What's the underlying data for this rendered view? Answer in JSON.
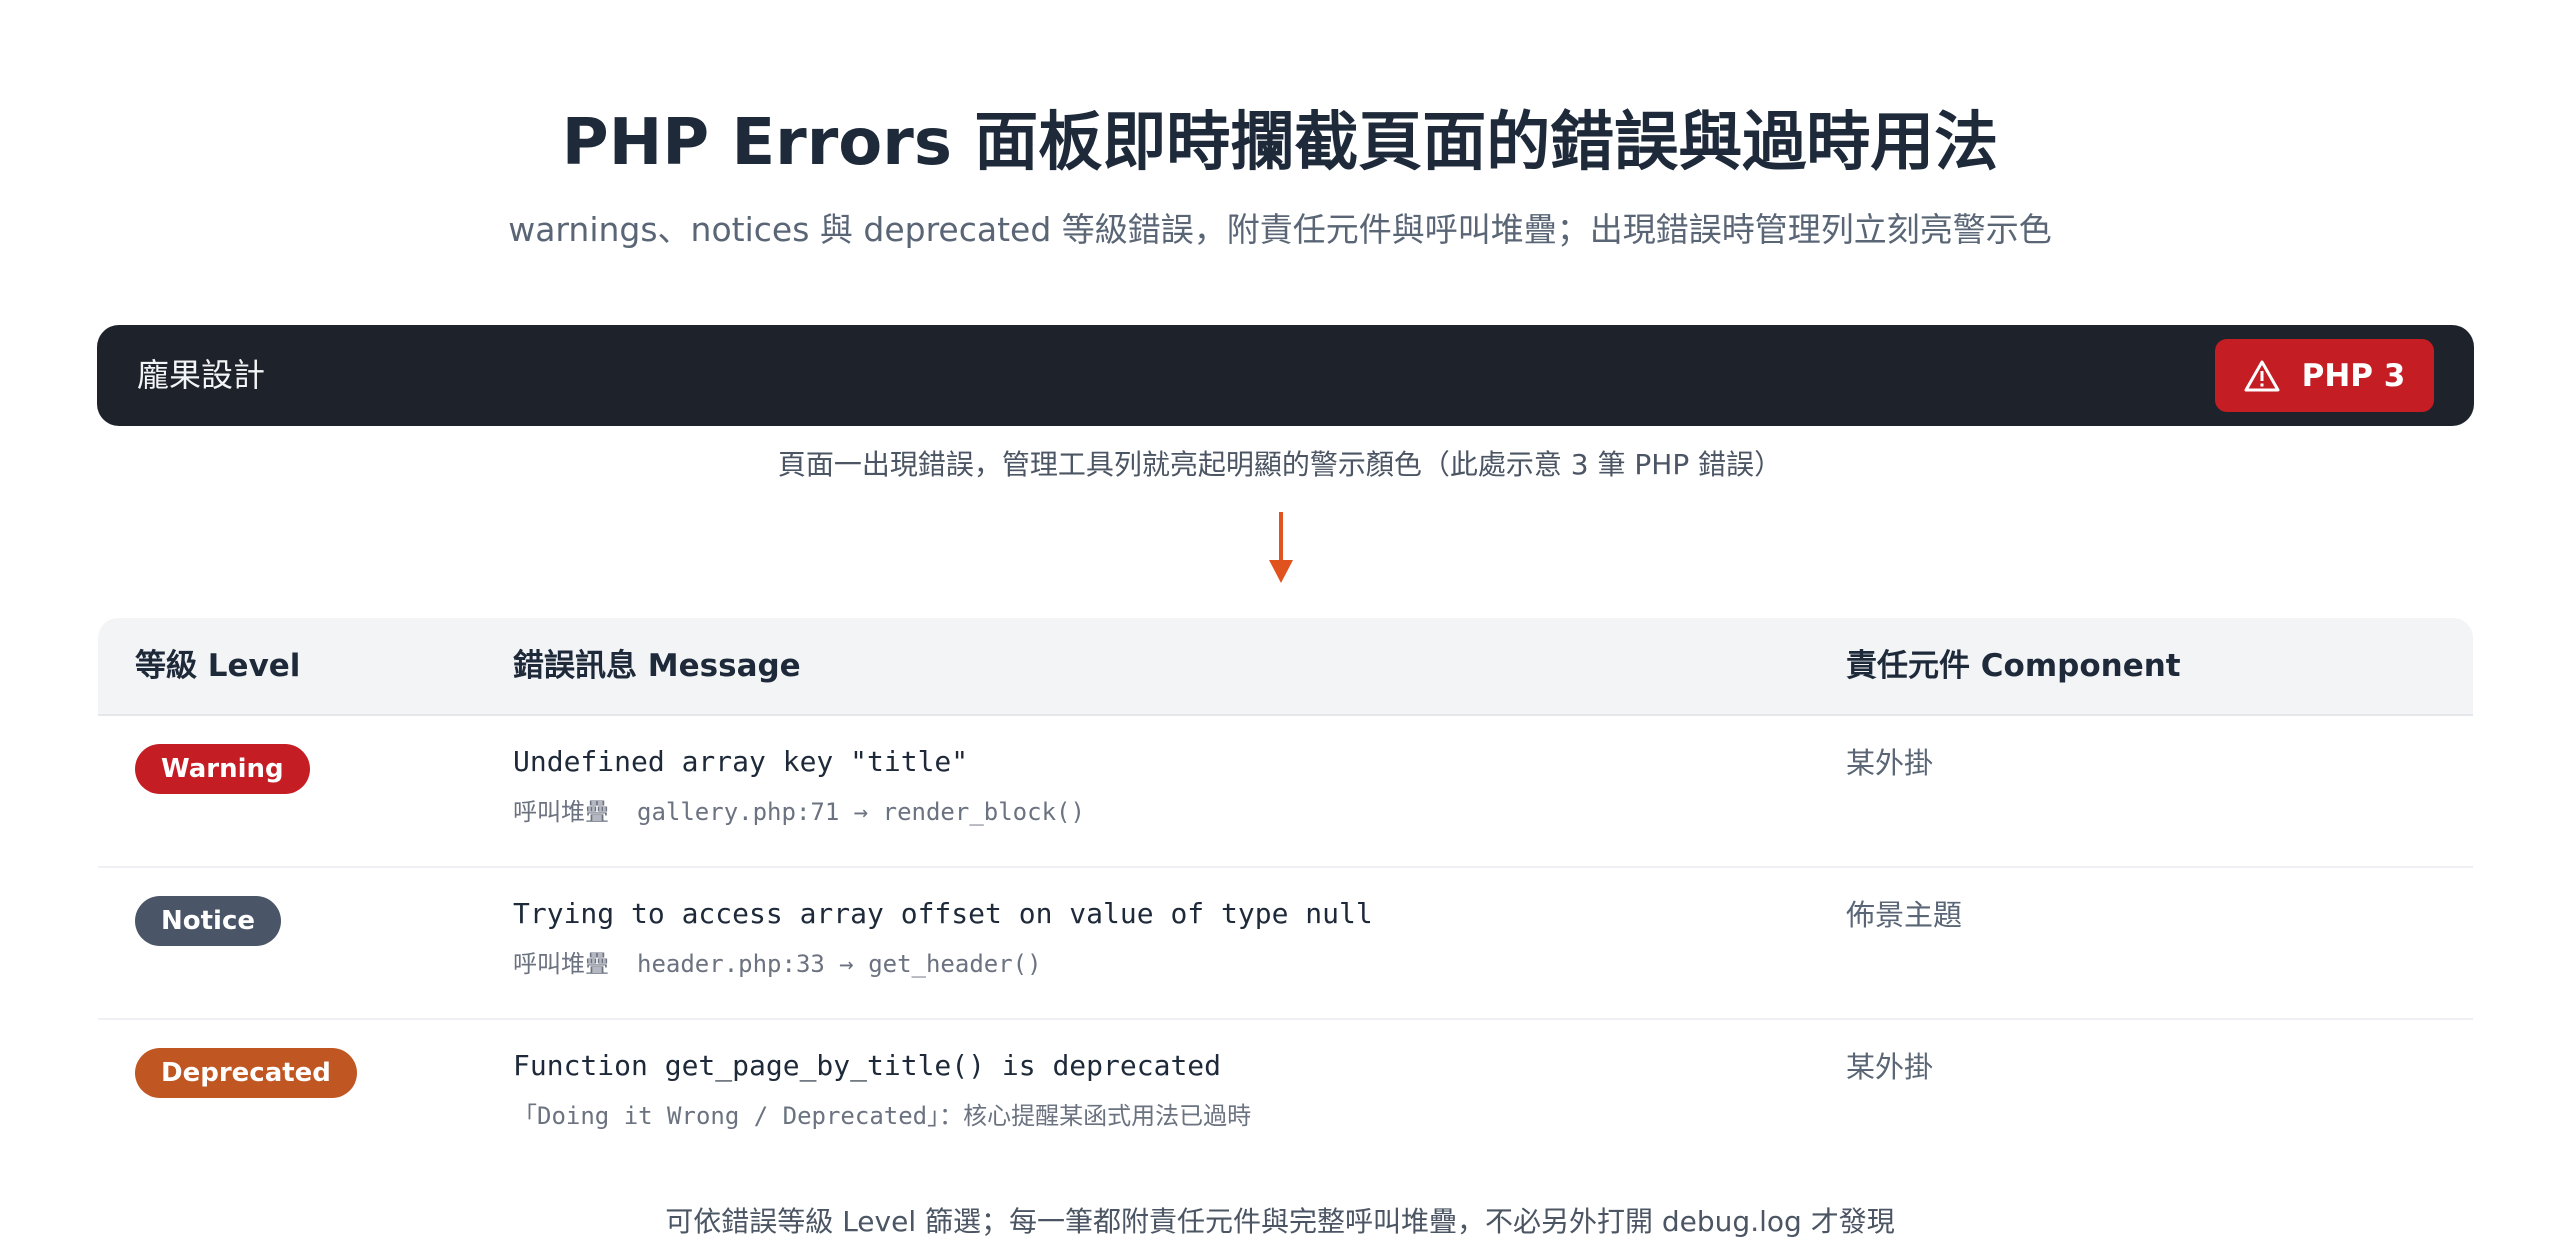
{
  "header": {
    "title": "PHP Errors 面板即時攔截頁面的錯誤與過時用法",
    "subtitle": "warnings、notices 與 deprecated 等級錯誤，附責任元件與呼叫堆疊；出現錯誤時管理列立刻亮警示色"
  },
  "admin_bar": {
    "site_name": "龐果設計",
    "badge_label": "PHP 3",
    "badge_icon": "warning-triangle-icon",
    "bg_color": "#1e232b",
    "badge_color": "#c41d24"
  },
  "bar_caption": "頁面一出現錯誤，管理工具列就亮起明顯的警示顏色（此處示意 3 筆 PHP 錯誤）",
  "arrow_icon": "arrow-down-icon",
  "table": {
    "columns": {
      "level": "等級 Level",
      "message": "錯誤訊息 Message",
      "component": "責任元件 Component"
    },
    "rows": [
      {
        "level": "Warning",
        "level_color": "#c41d24",
        "message": "Undefined array key \"title\"",
        "stack_label": "呼叫堆疊",
        "stack": "gallery.php:71 → render_block()",
        "note": "",
        "component": "某外掛"
      },
      {
        "level": "Notice",
        "level_color": "#4a5568",
        "message": "Trying to access array offset on value of type null",
        "stack_label": "呼叫堆疊",
        "stack": "header.php:33 → get_header()",
        "note": "",
        "component": "佈景主題"
      },
      {
        "level": "Deprecated",
        "level_color": "#c05621",
        "message": "Function get_page_by_title() is deprecated",
        "stack_label": "",
        "stack": "",
        "note_mono": "「Doing it Wrong / Deprecated」",
        "note_text": "：核心提醒某函式用法已過時",
        "component": "某外掛"
      }
    ]
  },
  "footer_note": "可依錯誤等級 Level 篩選；每一筆都附責任元件與完整呼叫堆疊，不必另外打開 debug.log 才發現",
  "accent_color": "#e0531f"
}
